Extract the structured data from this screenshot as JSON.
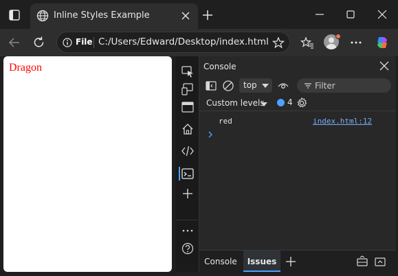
{
  "window": {
    "tab_title": "Inline Styles Example",
    "colors": {
      "frame": "#1f1f1f",
      "toolbar": "#2e2e2e",
      "accent": "#4aa3ff"
    }
  },
  "toolbar": {
    "scheme": "File",
    "url": "C:/Users/Edward/Desktop/index.html"
  },
  "page": {
    "text": "Dragon",
    "text_color": "#ff0000"
  },
  "devtools": {
    "panel_title": "Console",
    "context": "top",
    "filter_placeholder": "Filter",
    "levels_label": "Custom levels",
    "issues_count": "4",
    "log": {
      "message": "red",
      "source": "index.html:12"
    },
    "drawer_tabs": [
      "Console",
      "Issues"
    ]
  }
}
